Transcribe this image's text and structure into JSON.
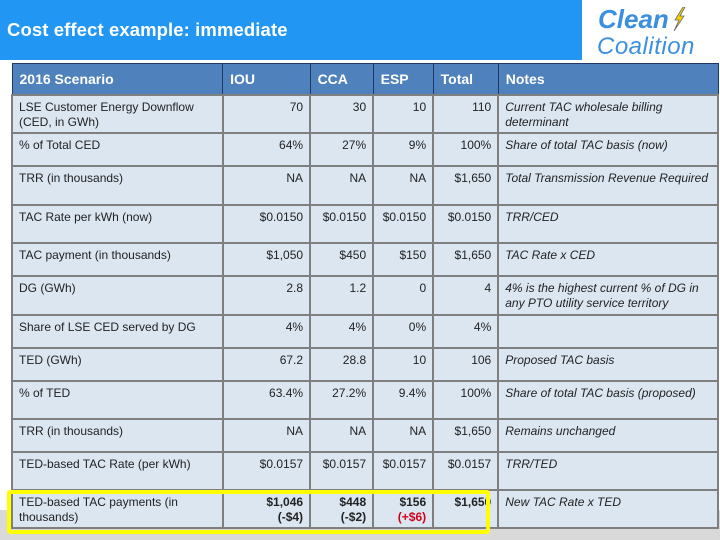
{
  "slide": {
    "title": "Cost effect example: immediate",
    "logo": {
      "line1": "Clean",
      "line2": "Coalition",
      "icon": "lightning-bolt-icon"
    },
    "colors": {
      "title_bar": "#2196f3",
      "header_fill": "#4f81bd",
      "cell_fill": "#dce6f1",
      "green_text": "#2e7d32",
      "red_text": "#d0021b",
      "highlight": "#ffff00"
    }
  },
  "table": {
    "headers": [
      "2016 Scenario",
      "IOU",
      "CCA",
      "ESP",
      "Total",
      "Notes"
    ],
    "rows": [
      {
        "label": "LSE Customer Energy Downflow (CED, in GWh)",
        "iou": "70",
        "cca": "30",
        "esp": "10",
        "total": "110",
        "notes": "Current TAC wholesale billing determinant"
      },
      {
        "label": "% of Total CED",
        "iou": "64%",
        "cca": "27%",
        "esp": "9%",
        "total": "100%",
        "notes": "Share of total TAC basis (now)"
      },
      {
        "label": "TRR (in thousands)",
        "iou": "NA",
        "cca": "NA",
        "esp": "NA",
        "total": "$1,650",
        "notes": "Total Transmission Revenue Required"
      },
      {
        "label": "TAC Rate per kWh (now)",
        "iou": "$0.0150",
        "cca": "$0.0150",
        "esp": "$0.0150",
        "total": "$0.0150",
        "notes": "TRR/CED"
      },
      {
        "label": "TAC payment (in thousands)",
        "iou": "$1,050",
        "cca": "$450",
        "esp": "$150",
        "total": "$1,650",
        "notes": "TAC Rate x CED"
      },
      {
        "label": "DG (GWh)",
        "iou": "2.8",
        "cca": "1.2",
        "esp": "0",
        "total": "4",
        "notes": "4% is the highest current % of DG in any PTO utility service territory"
      },
      {
        "label": "Share of LSE CED served by DG",
        "iou": "4%",
        "cca": "4%",
        "esp": "0%",
        "total": "4%",
        "notes": ""
      },
      {
        "label": "TED (GWh)",
        "iou": "67.2",
        "cca": "28.8",
        "esp": "10",
        "total": "106",
        "notes": "Proposed TAC basis"
      },
      {
        "label": "% of TED",
        "iou": "63.4%",
        "cca": "27.2%",
        "esp": "9.4%",
        "total": "100%",
        "notes": "Share of total TAC basis (proposed)"
      },
      {
        "label": "TRR (in thousands)",
        "iou": "NA",
        "cca": "NA",
        "esp": "NA",
        "total": "$1,650",
        "notes": "Remains unchanged"
      },
      {
        "label": "TED-based TAC Rate (per kWh)",
        "iou": "$0.0157",
        "cca": "$0.0157",
        "esp": "$0.0157",
        "total": "$0.0157",
        "notes": "TRR/TED"
      },
      {
        "label": "TED-based TAC payments (in thousands)",
        "iou": "$1,046",
        "iou_delta": "(-$4)",
        "cca": "$448",
        "cca_delta": "(-$2)",
        "esp": "$156",
        "esp_delta": "(+$6)",
        "total": "$1,650",
        "notes": "New TAC Rate x TED"
      }
    ]
  }
}
